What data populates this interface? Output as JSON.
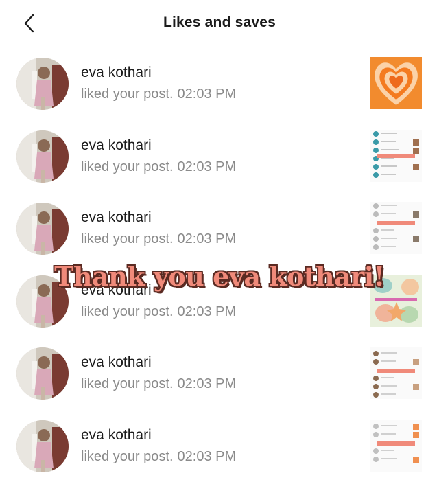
{
  "header": {
    "title": "Likes and saves",
    "back_icon": "chevron-left-icon"
  },
  "notifications": [
    {
      "name": "eva kothari",
      "action": "liked your post.",
      "time": "02:03 PM",
      "thumb": "orange-heart"
    },
    {
      "name": "eva kothari",
      "action": "liked your post.",
      "time": "02:03 PM",
      "thumb": "list-teal"
    },
    {
      "name": "eva kothari",
      "action": "liked your post.",
      "time": "02:03 PM",
      "thumb": "list-grey"
    },
    {
      "name": "eva kothari",
      "action": "liked your post.",
      "time": "02:03 PM",
      "thumb": "seashell"
    },
    {
      "name": "eva kothari",
      "action": "liked your post.",
      "time": "02:03 PM",
      "thumb": "list-brown"
    },
    {
      "name": "eva kothari",
      "action": "liked your post.",
      "time": "02:03 PM",
      "thumb": "list-orange"
    }
  ],
  "overlay_text": "Thank you eva kothari!"
}
